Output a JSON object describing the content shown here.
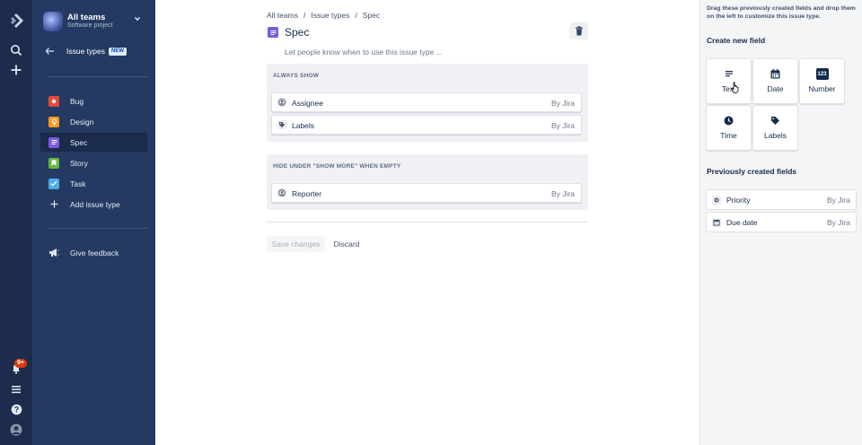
{
  "global_nav": {
    "notification_badge": "9+",
    "icons": [
      "jira-logo-icon",
      "search-icon",
      "create-icon",
      "notifications-icon",
      "menu-icon",
      "help-icon",
      "profile-avatar"
    ]
  },
  "sidebar": {
    "project_name": "All teams",
    "project_type": "Software project",
    "back_label": "Issue types",
    "new_badge": "NEW",
    "items": [
      {
        "label": "Bug",
        "color": "#e5493a"
      },
      {
        "label": "Design",
        "color": "#ff991f"
      },
      {
        "label": "Spec",
        "color": "#7a5ae0",
        "active": true
      },
      {
        "label": "Story",
        "color": "#63ba3c"
      },
      {
        "label": "Task",
        "color": "#4bade8"
      }
    ],
    "add_label": "Add issue type",
    "feedback_label": "Give feedback"
  },
  "main": {
    "breadcrumbs": [
      "All teams",
      "Issue types",
      "Spec"
    ],
    "title": "Spec",
    "description_placeholder": "Let people know when to use this issue type ...",
    "always_show": {
      "heading": "ALWAYS SHOW",
      "fields": [
        {
          "name": "Assignee",
          "by": "By Jira",
          "icon": "user-icon"
        },
        {
          "name": "Labels",
          "by": "By Jira",
          "icon": "label-icon"
        }
      ]
    },
    "hide_when_empty": {
      "heading": "HIDE UNDER \"SHOW MORE\" WHEN EMPTY",
      "fields": [
        {
          "name": "Reporter",
          "by": "By Jira",
          "icon": "user-icon"
        }
      ]
    },
    "save_label": "Save changes",
    "discard_label": "Discard"
  },
  "panel": {
    "hint": "Drag these previously created fields and drop them on the left to customize this issue type.",
    "create_heading": "Create new field",
    "field_types": [
      {
        "label": "Text",
        "icon": "text-icon"
      },
      {
        "label": "Date",
        "icon": "calendar-icon"
      },
      {
        "label": "Number",
        "icon": "number-icon",
        "glyph": "123"
      },
      {
        "label": "Time",
        "icon": "clock-icon"
      },
      {
        "label": "Labels",
        "icon": "label-icon"
      }
    ],
    "previous_heading": "Previously created fields",
    "previous_fields": [
      {
        "name": "Priority",
        "by": "By Jira",
        "icon": "priority-icon"
      },
      {
        "name": "Due date",
        "by": "By Jira",
        "icon": "calendar-icon"
      }
    ]
  }
}
